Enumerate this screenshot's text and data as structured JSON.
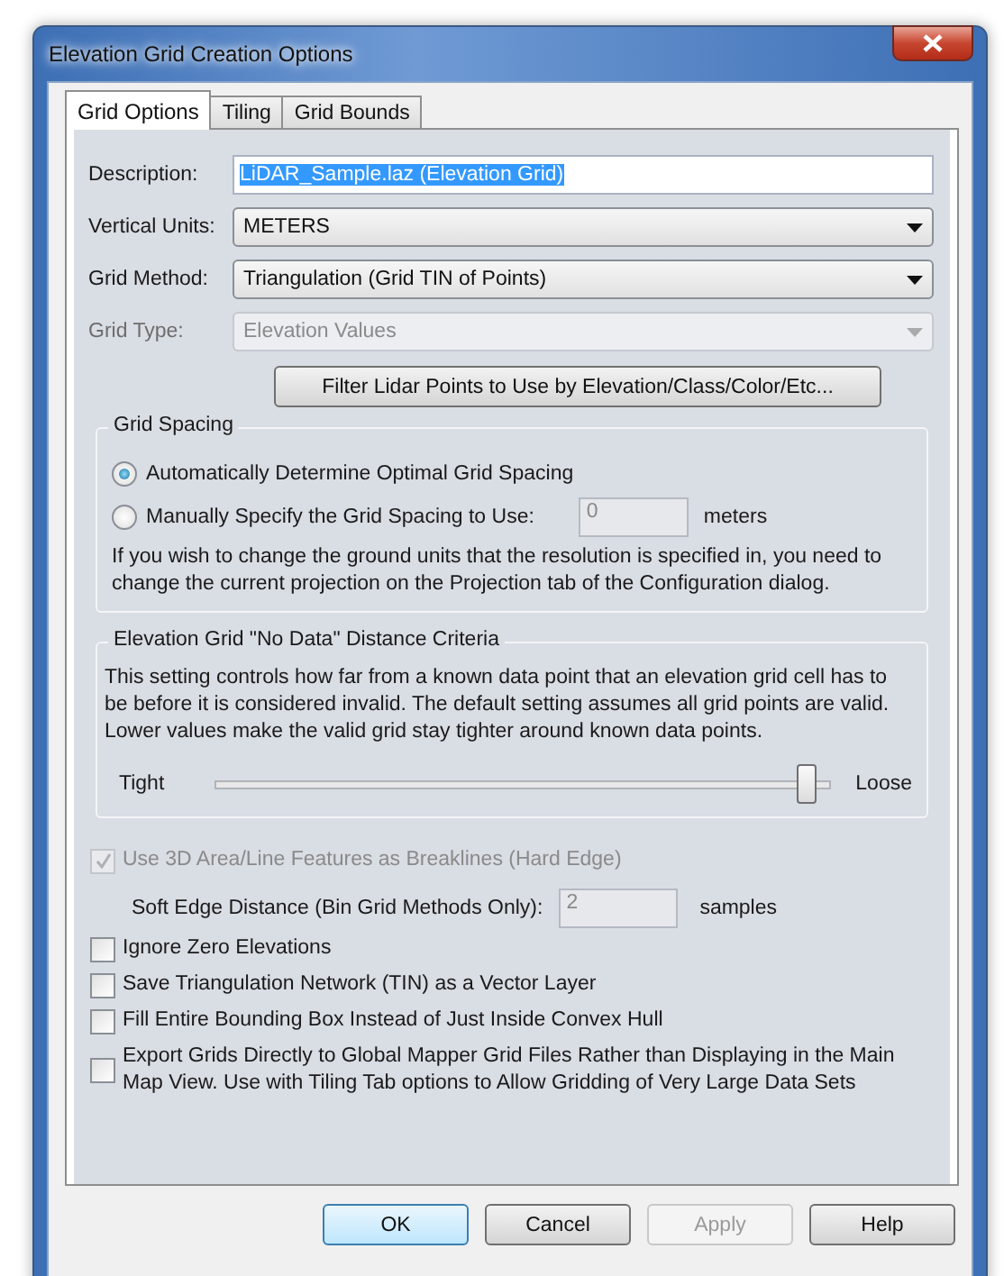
{
  "window": {
    "title": "Elevation Grid Creation Options"
  },
  "tabs": [
    {
      "label": "Grid Options",
      "selected": true
    },
    {
      "label": "Tiling",
      "selected": false
    },
    {
      "label": "Grid Bounds",
      "selected": false
    }
  ],
  "fields": [
    {
      "kind": "text",
      "label": "Description:",
      "value": "LiDAR_Sample.laz (Elevation Grid)",
      "highlighted": true
    },
    {
      "kind": "dropdown",
      "label": "Vertical Units:",
      "value": "METERS",
      "disabled": false
    },
    {
      "kind": "dropdown",
      "label": "Grid Method:",
      "value": "Triangulation (Grid TIN of Points)",
      "disabled": false
    },
    {
      "kind": "dropdown",
      "label": "Grid Type:",
      "value": "Elevation Values",
      "disabled": true
    }
  ],
  "filter_button": {
    "label": "Filter Lidar Points to Use by Elevation/Class/Color/Etc..."
  },
  "grid_spacing": {
    "title": "Grid Spacing",
    "options": [
      {
        "label": "Automatically Determine Optimal Grid Spacing",
        "selected": true
      },
      {
        "label": "Manually Specify the Grid Spacing to Use:",
        "selected": false
      }
    ],
    "spacing_value": "0",
    "spacing_unit": "meters",
    "note": "If you wish to change the ground units that the resolution is specified in, you need to change the current projection on the Projection tab of the Configuration dialog."
  },
  "no_data": {
    "title": "Elevation Grid \"No Data\" Distance Criteria",
    "description": "This setting controls how far from a known data point that an elevation grid cell has to be before it is considered invalid. The default setting assumes all grid points are valid. Lower values make the valid grid stay tighter around known data points.",
    "slider": {
      "min_label": "Tight",
      "max_label": "Loose",
      "level": 0.96
    }
  },
  "breaklines": {
    "label": "Use 3D Area/Line Features as Breaklines (Hard Edge)",
    "checked": true,
    "disabled": true
  },
  "soft_edge": {
    "label": "Soft Edge Distance (Bin Grid Methods Only):",
    "value": "2",
    "unit": "samples",
    "disabled": true
  },
  "checkboxes": [
    {
      "label": "Ignore Zero Elevations",
      "checked": false
    },
    {
      "label": "Save Triangulation Network (TIN) as a Vector Layer",
      "checked": false
    },
    {
      "label": "Fill Entire Bounding Box Instead of Just Inside Convex Hull",
      "checked": false
    },
    {
      "label": "Export Grids Directly to Global Mapper Grid Files Rather than Displaying in the Main Map View. Use with Tiling Tab options to Allow Gridding of Very Large Data Sets",
      "checked": false
    }
  ],
  "buttons": [
    {
      "label": "OK",
      "default": true,
      "disabled": false
    },
    {
      "label": "Cancel",
      "default": false,
      "disabled": false
    },
    {
      "label": "Apply",
      "default": false,
      "disabled": true
    },
    {
      "label": "Help",
      "default": false,
      "disabled": false
    }
  ]
}
